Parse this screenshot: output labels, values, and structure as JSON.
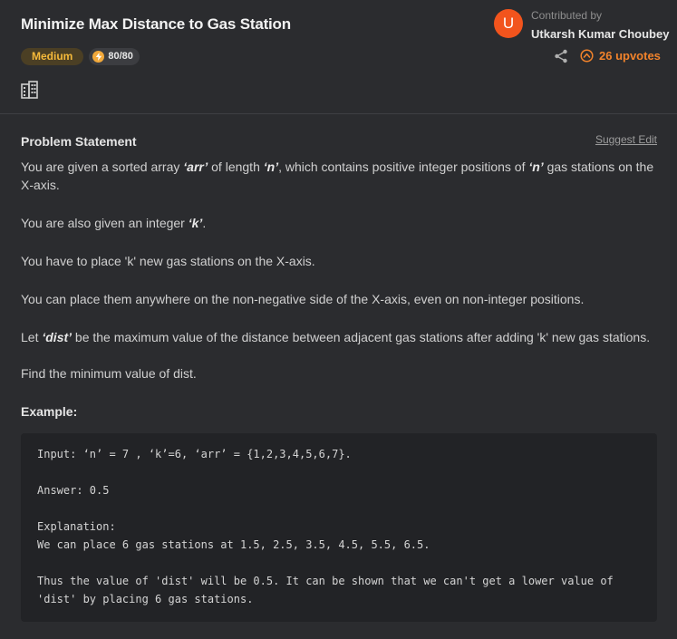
{
  "problem": {
    "title": "Minimize Max Distance to Gas Station",
    "difficulty": "Medium",
    "score": "80/80"
  },
  "contributor": {
    "avatar_letter": "U",
    "label": "Contributed by",
    "name": "Utkarsh Kumar Choubey",
    "upvotes": "26 upvotes"
  },
  "statement": {
    "heading": "Problem Statement",
    "suggest_edit": "Suggest Edit",
    "p1_a": "You are given a sorted array ",
    "p1_arr": "‘arr’",
    "p1_b": " of length ",
    "p1_n1": "‘n’",
    "p1_c": ", which contains positive integer positions of ",
    "p1_n2": "‘n’",
    "p1_d": " gas stations on the X-axis.",
    "p2_a": "You are also given an integer ",
    "p2_k": "‘k’",
    "p2_b": ".",
    "p3": "You have to place 'k' new gas stations on the X-axis.",
    "p4": "You can place them anywhere on the non-negative side of the X-axis, even on non-integer positions.",
    "p5_a": "Let ",
    "p5_dist": "‘dist’",
    "p5_b": " be the maximum value of the distance between adjacent gas stations after adding 'k' new gas stations.",
    "p6": "Find the minimum value of dist."
  },
  "example": {
    "heading": "Example:",
    "lines": [
      "Input: ‘n’ = 7 , ‘k’=6, ‘arr’ = {1,2,3,4,5,6,7}.",
      "Answer: 0.5",
      "Explanation:",
      "We can place 6 gas stations at 1.5, 2.5, 3.5, 4.5, 5.5, 6.5.",
      "Thus the value of 'dist' will be 0.5. It can be shown that we can't get a lower value of",
      "'dist' by placing 6 gas stations."
    ]
  },
  "icons": {
    "score": "bolt-icon",
    "company": "building-icon",
    "share": "share-icon",
    "upvote": "upvote-icon"
  },
  "colors": {
    "background": "#2b2c2f",
    "accent_orange": "#f2832b",
    "difficulty_text": "#f5b93a",
    "avatar_bg": "#f2541d",
    "code_bg": "#222326"
  }
}
